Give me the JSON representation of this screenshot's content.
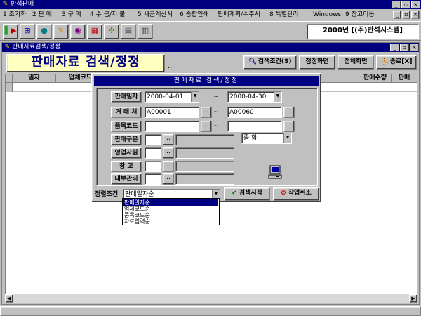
{
  "app": {
    "title": "반석판매",
    "icon": "pen-app-icon",
    "window_buttons": [
      "_",
      "▫",
      "×"
    ]
  },
  "menu": {
    "items": [
      "1 초기화",
      "2 판 매",
      "3 구 매",
      "4 수 금/지 불",
      "5 세금계산서",
      "6 종합인쇄",
      "판매계획/수주서",
      "8 특별관리",
      "Windows",
      "9 창고이동"
    ],
    "mdi_buttons": [
      "_",
      "▫",
      "×"
    ]
  },
  "toolbar": {
    "icons": [
      "exit-door-icon",
      "network-icon",
      "globe-icon",
      "pencil-icon",
      "eye-icon",
      "table-icon",
      "grid-icon",
      "calculator-icon",
      "printer-icon"
    ],
    "company": "2000년 [(주)반석시스템]"
  },
  "window": {
    "title": "판매자료검색/정정",
    "window_buttons": [
      "_",
      "▫",
      "×"
    ],
    "heading": "판매자료 검색/정정",
    "dots": "..",
    "buttons": {
      "search_cond": "검색조건(S)",
      "edit_view": "정정화면",
      "full_view": "전체화면",
      "exit": "종료[X]"
    },
    "grid": {
      "headers": [
        "일자",
        "업체코드",
        "판매수량",
        "판매"
      ]
    }
  },
  "dialog": {
    "title": "판매자료 검색/정정",
    "labels": {
      "sale_date": "판매일자",
      "customer": "거 래 처",
      "item_code": "품목코드",
      "sale_type": "판매구분",
      "sales_rep": "영업사원",
      "warehouse": "창 고",
      "internal": "내부관리"
    },
    "fields": {
      "date_from": "2000-04-01",
      "date_to": "2000-04-30",
      "customer_from": "A00001",
      "customer_to": "A00060",
      "item_from": "",
      "item_to": "",
      "sale_type_select": "종    합"
    },
    "tilde": "~",
    "browse": "..",
    "sort_label": "정렬조건",
    "sort_value": "판매일자순",
    "search_start": "검색시작",
    "cancel": "작업취소"
  },
  "sort_options": [
    "판매일자순",
    "업체코드순",
    "품목코드순",
    "자료입력순"
  ],
  "colors": {
    "titlebar": "#000080",
    "face": "#c0c0c0",
    "heading_bg": "#ffffc0",
    "heading_text": "#000080",
    "check_green": "#008000",
    "cancel_red": "#c00000"
  }
}
